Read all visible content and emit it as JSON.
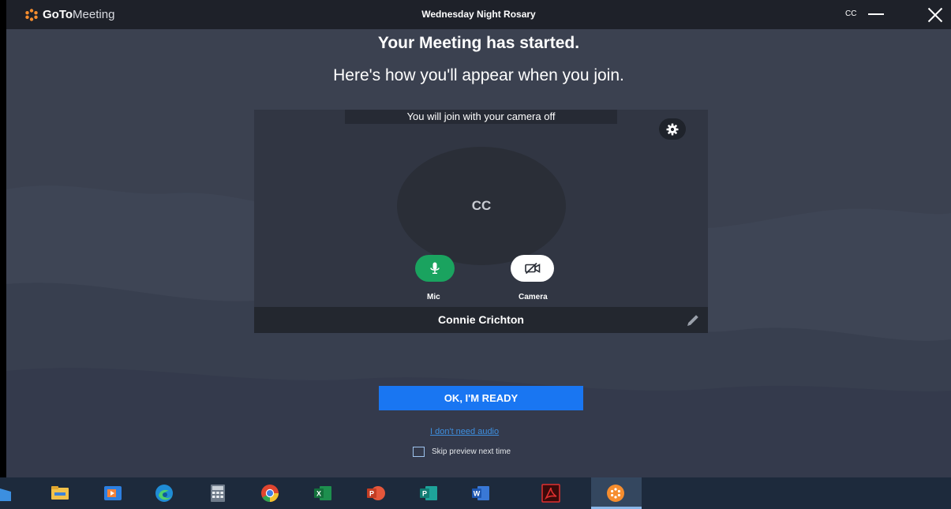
{
  "app": {
    "logo_bold": "GoTo",
    "logo_light": "Meeting",
    "window_title": "Wednesday Night Rosary"
  },
  "titlebar": {
    "user_initials": "CC"
  },
  "main": {
    "heading": "Your Meeting has started.",
    "subheading": "Here's how you'll appear when you join.",
    "preview": {
      "camera_status": "You will join with your camera off",
      "avatar_initials": "CC",
      "mic_label": "Mic",
      "camera_label": "Camera",
      "display_name": "Connie Crichton"
    },
    "ready_button": "OK, I'M READY",
    "no_audio_link": "I don't need audio",
    "skip_preview_label": "Skip preview next time"
  },
  "taskbar": {
    "icons": [
      "partial-app-icon",
      "file-explorer-icon",
      "media-player-icon",
      "edge-icon",
      "calculator-icon",
      "chrome-icon",
      "excel-icon",
      "powerpoint-icon",
      "publisher-icon",
      "word-icon",
      "acrobat-icon",
      "gotomeeting-icon"
    ]
  },
  "colors": {
    "accent_blue": "#1976f2",
    "mic_green": "#1aa35f",
    "logo_orange": "#f68d2e",
    "link_blue": "#3e8fdf",
    "background": "#3b4150"
  }
}
